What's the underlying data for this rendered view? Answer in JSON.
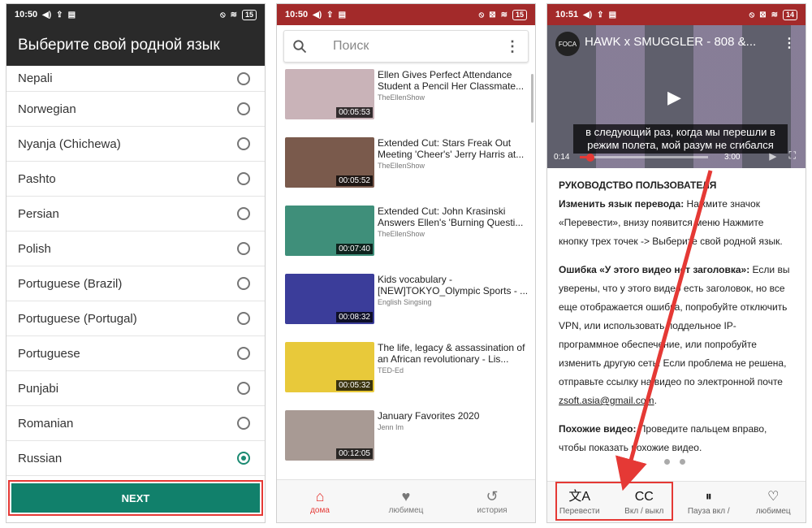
{
  "colors": {
    "accent_green": "#11806b",
    "brand_red": "#a32a2a",
    "highlight_red": "#e53935"
  },
  "phone1": {
    "status": {
      "time": "10:50",
      "battery": "15"
    },
    "title": "Выберите свой родной язык",
    "languages": [
      {
        "name": "Nepali",
        "selected": false
      },
      {
        "name": "Norwegian",
        "selected": false
      },
      {
        "name": "Nyanja (Chichewa)",
        "selected": false
      },
      {
        "name": "Pashto",
        "selected": false
      },
      {
        "name": "Persian",
        "selected": false
      },
      {
        "name": "Polish",
        "selected": false
      },
      {
        "name": "Portuguese (Brazil)",
        "selected": false
      },
      {
        "name": "Portuguese (Portugal)",
        "selected": false
      },
      {
        "name": "Portuguese",
        "selected": false
      },
      {
        "name": "Punjabi",
        "selected": false
      },
      {
        "name": "Romanian",
        "selected": false
      },
      {
        "name": "Russian",
        "selected": true
      }
    ],
    "next_label": "NEXT"
  },
  "phone2": {
    "status": {
      "time": "10:50",
      "battery": "15"
    },
    "search_placeholder": "Поиск",
    "videos": [
      {
        "title": "Ellen Gives Perfect Attendance Student a Pencil Her Classmate...",
        "channel": "TheEllenShow",
        "duration": "00:05:53",
        "thumb": "#c9b3b8"
      },
      {
        "title": "Extended Cut: Stars Freak Out Meeting 'Cheer's' Jerry Harris at...",
        "channel": "TheEllenShow",
        "duration": "00:05:52",
        "thumb": "#7a5a4c"
      },
      {
        "title": "Extended Cut: John Krasinski Answers Ellen's 'Burning Questi...",
        "channel": "TheEllenShow",
        "duration": "00:07:40",
        "thumb": "#3f8f7a"
      },
      {
        "title": "Kids vocabulary - [NEW]TOKYO_Olympic Sports - ...",
        "channel": "English Singsing",
        "duration": "00:08:32",
        "thumb": "#3b3d9a"
      },
      {
        "title": "The life, legacy & assassination of an African revolutionary - Lis...",
        "channel": "TED-Ed",
        "duration": "00:05:32",
        "thumb": "#e8c93a"
      },
      {
        "title": "January Favorites 2020",
        "channel": "Jenn Im",
        "duration": "00:12:05",
        "thumb": "#a89a94"
      }
    ],
    "nav": [
      {
        "label": "дома",
        "icon": "⌂",
        "active": true
      },
      {
        "label": "любимец",
        "icon": "♥",
        "active": false
      },
      {
        "label": "история",
        "icon": "↺",
        "active": false
      }
    ]
  },
  "phone3": {
    "status": {
      "time": "10:51",
      "battery": "14"
    },
    "player": {
      "title": "HAWK x SMUGGLER - 808 &...",
      "subtitle": "в следующий раз, когда мы перешли в режим полета, мой разум не сгибался",
      "current_time": "0:14",
      "total_time": "3:00",
      "progress": 0.08,
      "logo_text": "FOCA"
    },
    "guide": {
      "heading": "РУКОВОДСТВО ПОЛЬЗОВАТЕЛЯ",
      "p1_label": "Изменить язык перевода:",
      "p1_text": " Нажмите значок «Перевести», внизу появится меню Нажмите кнопку трех точек -> Выберите свой родной язык.",
      "p2_label": "Ошибка «У этого видео нет заголовка»:",
      "p2_text": " Если вы уверены, что у этого видео есть заголовок, но все еще отображается ошибка, попробуйте отключить VPN, или использовать поддельное IP-программное обеспечение, или попробуйте изменить другую сеть. Если проблема не решена, отправьте ссылку на видео по электронной почте ",
      "p2_email": "zsoft.asia@gmail.com",
      "p2_end": ".",
      "p3_label": "Похожие видео:",
      "p3_text": " Проведите пальцем вправо, чтобы показать похожие видео."
    },
    "nav": [
      {
        "label": "Перевести",
        "icon": "文A"
      },
      {
        "label": "Вкл / выкл",
        "icon": "CC"
      },
      {
        "label": "Пауза вкл /",
        "icon": "⏸"
      },
      {
        "label": "любимец",
        "icon": "♡"
      }
    ]
  }
}
